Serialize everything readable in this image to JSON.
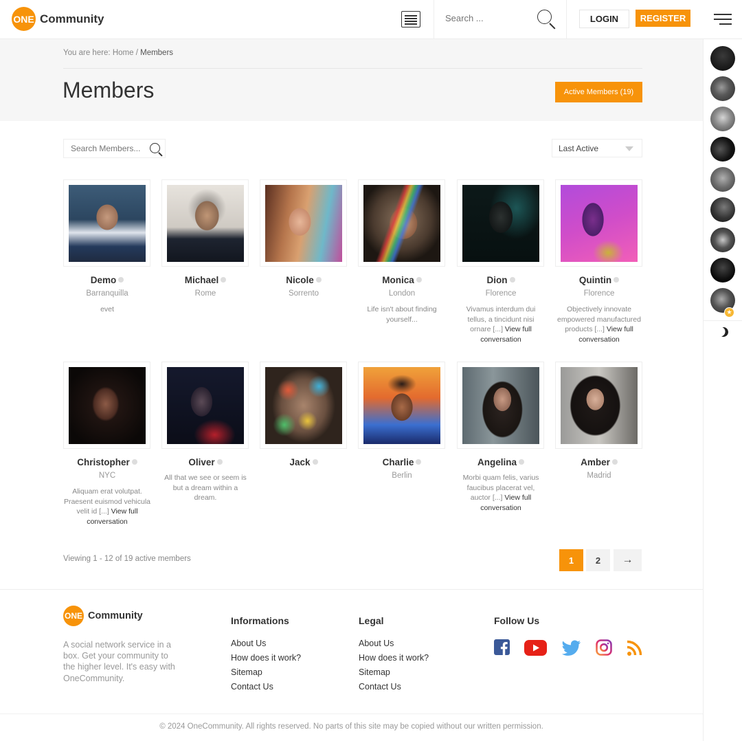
{
  "header": {
    "logo_badge": "ONE",
    "logo_text": "Community",
    "search_placeholder": "Search ...",
    "login_label": "LOGIN",
    "register_label": "REGISTER"
  },
  "breadcrumb": {
    "prefix": "You are here: ",
    "home": "Home",
    "separator": " / ",
    "current": "Members"
  },
  "page": {
    "title": "Members",
    "active_members_label": "Active Members (19)"
  },
  "filters": {
    "search_placeholder": "Search Members...",
    "sort_value": "Last Active"
  },
  "members": [
    {
      "name": "Demo",
      "location": "Barranquilla",
      "desc": "evet",
      "more": ""
    },
    {
      "name": "Michael",
      "location": "Rome",
      "desc": "",
      "more": ""
    },
    {
      "name": "Nicole",
      "location": "Sorrento",
      "desc": "",
      "more": ""
    },
    {
      "name": "Monica",
      "location": "London",
      "desc": "Life isn't about finding yourself...",
      "more": ""
    },
    {
      "name": "Dion",
      "location": "Florence",
      "desc": "Vivamus interdum dui tellus, a tincidunt nisi ornare [...]",
      "more": "View full conversation"
    },
    {
      "name": "Quintin",
      "location": "Florence",
      "desc": "Objectively innovate empowered manufactured products [...]",
      "more": "View full conversation"
    },
    {
      "name": "Christopher",
      "location": "NYC",
      "desc": "Aliquam erat volutpat. Praesent euismod vehicula velit id [...]",
      "more": "View full conversation"
    },
    {
      "name": "Oliver",
      "location": "",
      "desc": "All that we see or seem is but a dream within a dream.",
      "more": ""
    },
    {
      "name": "Jack",
      "location": "",
      "desc": "",
      "more": ""
    },
    {
      "name": "Charlie",
      "location": "Berlin",
      "desc": "",
      "more": ""
    },
    {
      "name": "Angelina",
      "location": "",
      "desc": "Morbi quam felis, varius faucibus placerat vel, auctor [...]",
      "more": "View full conversation"
    },
    {
      "name": "Amber",
      "location": "Madrid",
      "desc": "",
      "more": ""
    }
  ],
  "pagination": {
    "viewing": "Viewing 1 - 12 of 19 active members",
    "pages": [
      "1",
      "2"
    ],
    "next": "→"
  },
  "footer": {
    "logo_badge": "ONE",
    "logo_text": "Community",
    "about": "A social network service in a box. Get your community to the higher level. It's easy with OneCommunity.",
    "informations_title": "Informations",
    "informations_links": [
      "About Us",
      "How does it work?",
      "Sitemap",
      "Contact Us"
    ],
    "legal_title": "Legal",
    "legal_links": [
      "About Us",
      "How does it work?",
      "Sitemap",
      "Contact Us"
    ],
    "follow_title": "Follow Us",
    "social_icons": [
      "facebook-icon",
      "youtube-icon",
      "twitter-icon",
      "instagram-icon",
      "rss-icon"
    ],
    "copyright": "© 2024 OneCommunity. All rights reserved. No parts of this site may be copied without our written permission."
  },
  "colors": {
    "accent": "#f7930a",
    "facebook": "#3b5998",
    "youtube": "#e62117",
    "twitter": "#55acee",
    "instagram": "#c13584",
    "rss": "#f7930a"
  }
}
